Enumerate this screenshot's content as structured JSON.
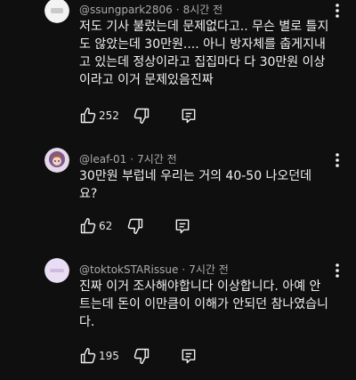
{
  "comments": [
    {
      "author": "@ssungpark2806",
      "time": "8시간 전",
      "text_lines": [
        "저도 기사 불렀는데 문제없다고.. 무슨 별로 틀지",
        "도 않았는데 30만원.... 아니 방자체를 춥게지내",
        "고 있는데 정상이라고 집집마다 다 30만원 이상",
        "이라고 이거 문제있음진짜"
      ],
      "likes": "252",
      "avatar_color": "#f3f3f3"
    },
    {
      "author": "@leaf-01",
      "time": "7시간 전",
      "text_lines": [
        "30만원 부럽네 우리는 거의 40-50 나오던데",
        "요?"
      ],
      "likes": "62",
      "avatar_color": "#7b5a8c"
    },
    {
      "author": "@toktokSTARissue",
      "time": "7시간 전",
      "text_lines": [
        "진짜 이거 조사해야합니다 이상합니다. 아예 안",
        "트는데 돈이 이만큼이 이해가 안되던 참나였습니",
        "다."
      ],
      "likes": "195",
      "avatar_color": "#e9ddf4"
    }
  ],
  "meta_separator": "·",
  "icons": [
    "thumbs-up-icon",
    "thumbs-down-icon",
    "reply-icon",
    "more-vertical-icon"
  ],
  "colors": {
    "background": "#0f0f0f",
    "text": "#f1f1f1",
    "meta": "#aaaaaa"
  }
}
